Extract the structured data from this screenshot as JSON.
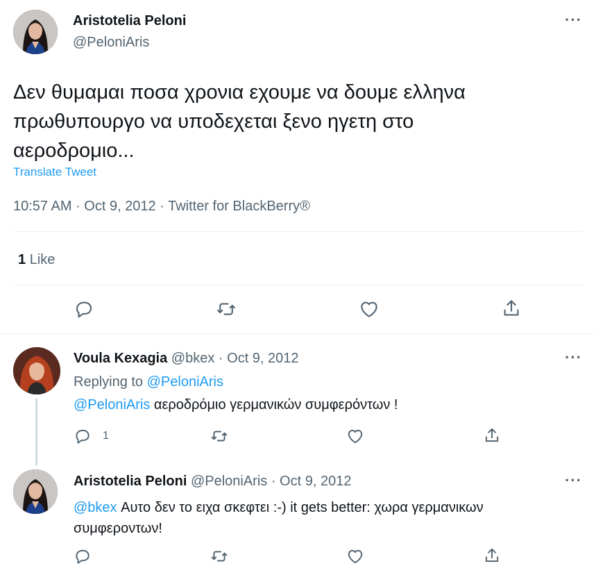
{
  "main_tweet": {
    "author_name": "Aristotelia Peloni",
    "author_handle": "@PeloniAris",
    "text_lines": [
      "Δεν θυμαμαι ποσα χρονια εχουμε να δουμε ελληνα",
      "πρωθυπουργο να υποδεχεται ξενο ηγετη στο",
      "αεροδρομιο..."
    ],
    "translate_label": "Translate Tweet",
    "meta": "10:57 AM · Oct 9, 2012 · Twitter for BlackBerry®",
    "likes_count": "1",
    "likes_label": "Like",
    "icons": [
      "reply-icon",
      "retweet-icon",
      "like-icon",
      "share-icon"
    ]
  },
  "replies": [
    {
      "author_name": "Voula Kexagia",
      "author_handle": "@bkex",
      "date": "· Oct 9, 2012",
      "replying_prefix": "Replying to ",
      "replying_to": "@PeloniAris",
      "mention": "@PeloniAris",
      "text": " αεροδρόμιο γερμανικών συμφερόντων !",
      "reply_count": "1"
    },
    {
      "author_name": "Aristotelia Peloni",
      "author_handle": "@PeloniAris",
      "date": "· Oct 9, 2012",
      "mention": "@bkex",
      "text_line1": " Αυτο δεν το ειχα σκεφτει :-) it gets better: χωρα γερμανικων",
      "text_line2": "συμφεροντων!"
    }
  ],
  "colors": {
    "link": "#1d9bf0",
    "muted": "#536471",
    "text": "#0f1419",
    "divider": "#eff3f4"
  }
}
